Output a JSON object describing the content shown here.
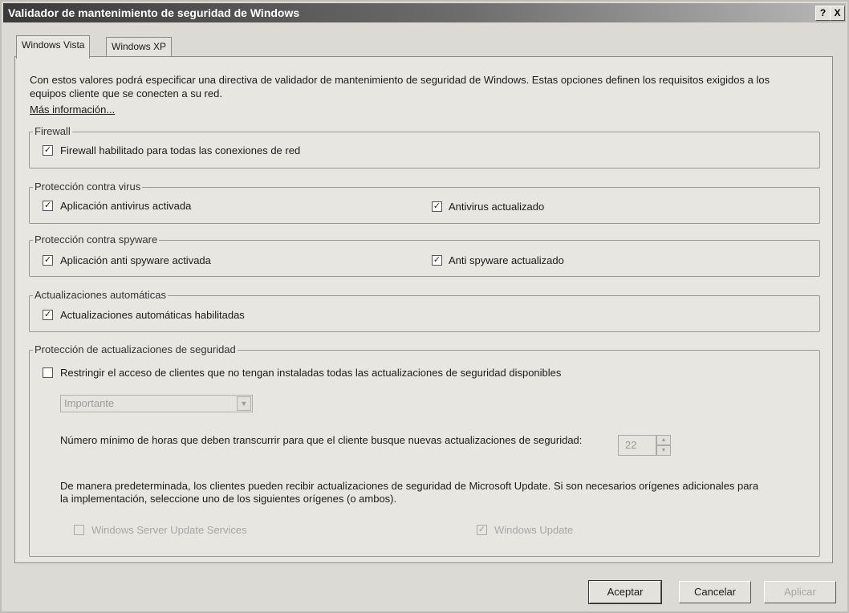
{
  "window": {
    "title": "Validador de mantenimiento de seguridad de Windows",
    "help_label": "?",
    "close_label": "X"
  },
  "tabs": [
    {
      "label": "Windows Vista"
    },
    {
      "label": "Windows XP"
    }
  ],
  "intro": {
    "text": "Con estos valores podrá especificar una directiva de validador de mantenimiento de seguridad de Windows. Estas opciones definen los requisitos exigidos a los equipos cliente que se conecten a su red.",
    "link": "Más información..."
  },
  "firewall": {
    "legend": "Firewall",
    "option": {
      "label": "Firewall habilitado para todas las conexiones de red",
      "checked": true
    }
  },
  "virus": {
    "legend": "Protección contra virus",
    "option1": {
      "label": "Aplicación antivirus activada",
      "checked": true
    },
    "option2": {
      "label": "Antivirus actualizado",
      "checked": true
    }
  },
  "spyware": {
    "legend": "Protección contra spyware",
    "option1": {
      "label": "Aplicación anti spyware activada",
      "checked": true
    },
    "option2": {
      "label": "Anti spyware actualizado",
      "checked": true
    }
  },
  "updates": {
    "legend": "Actualizaciones automáticas",
    "option": {
      "label": "Actualizaciones automáticas habilitadas",
      "checked": true
    }
  },
  "security": {
    "legend": "Protección de actualizaciones de seguridad",
    "restrict": {
      "label": "Restringir el acceso de clientes que no tengan instaladas todas las actualizaciones de seguridad disponibles",
      "checked": false
    },
    "severity_value": "Importante",
    "hours_label": "Número mínimo de horas que deben transcurrir para que el cliente busque nuevas actualizaciones de seguridad:",
    "hours_value": "22",
    "sources_text": "De manera predeterminada, los clientes pueden recibir actualizaciones de seguridad de Microsoft Update. Si son necesarios orígenes adicionales para la implementación, seleccione uno de los siguientes orígenes (o ambos).",
    "wsus": {
      "label": "Windows Server Update Services",
      "checked": false
    },
    "wu": {
      "label": "Windows Update",
      "checked": true
    }
  },
  "buttons": {
    "ok": "Aceptar",
    "cancel": "Cancelar",
    "apply": "Aplicar"
  }
}
